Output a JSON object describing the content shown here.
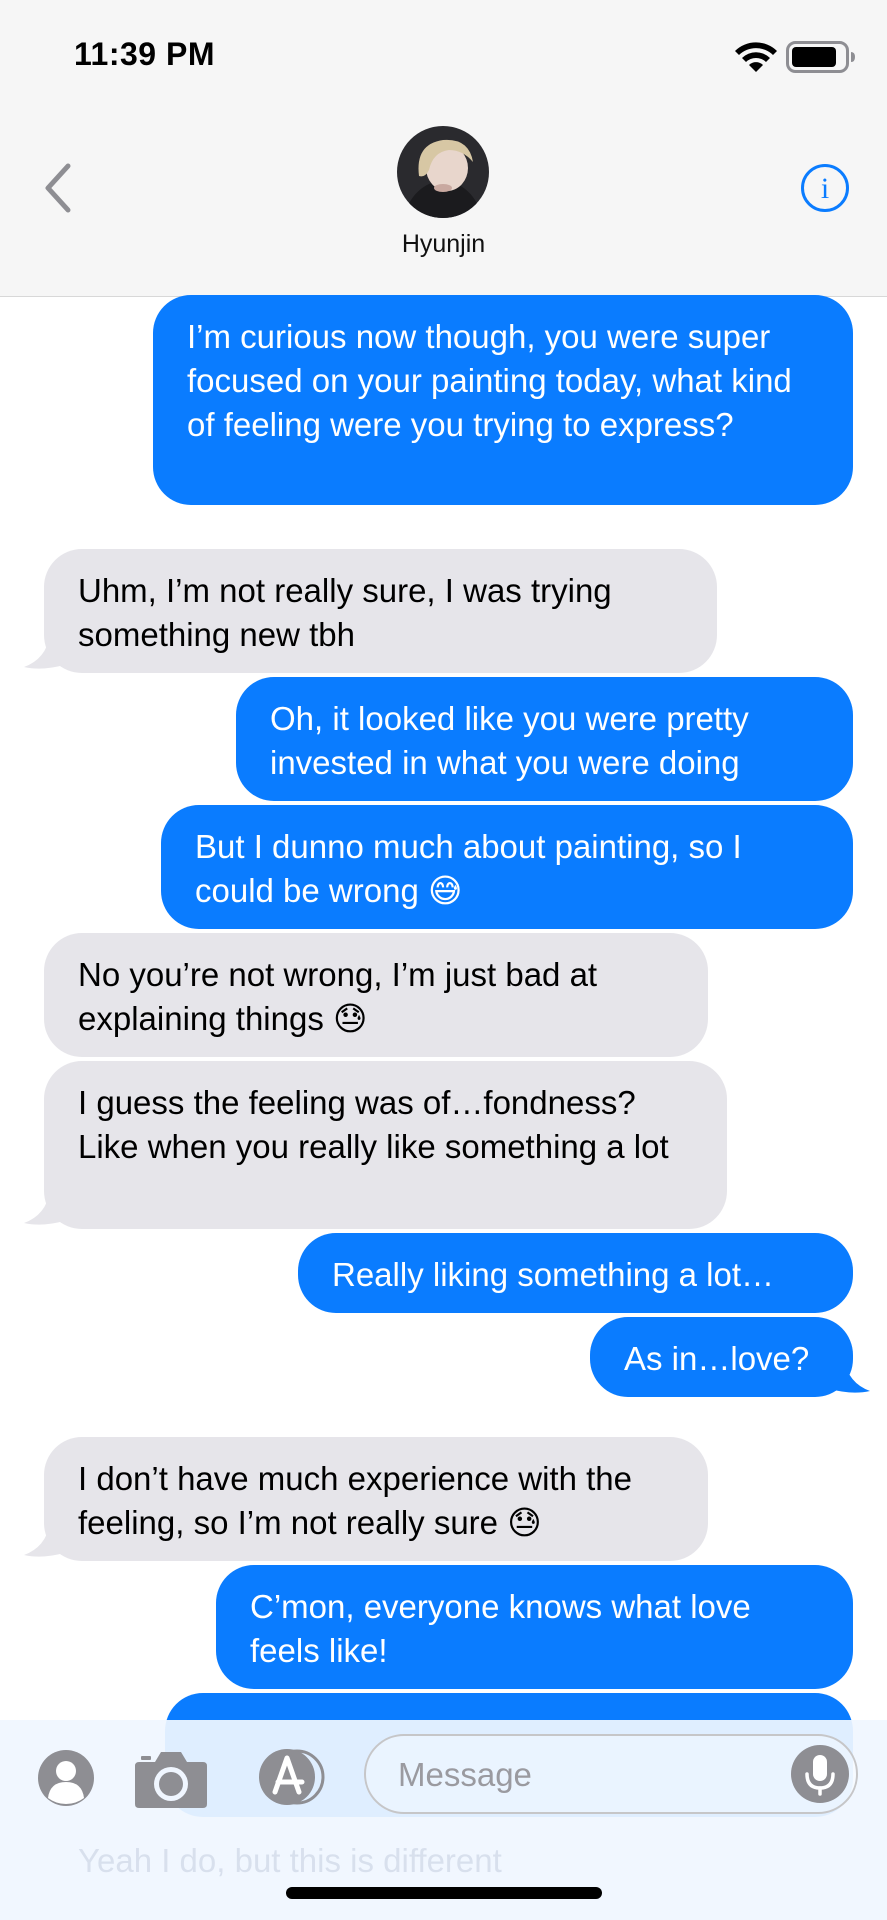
{
  "status_bar": {
    "time": "11:39 PM"
  },
  "header": {
    "contact_name": "Hyunjin"
  },
  "messages": [
    {
      "direction": "out",
      "text": "I’m curious now though, you were super focused on your painting today, what kind of feeling were you trying to express?"
    },
    {
      "direction": "in",
      "text": "Uhm, I’m not really sure, I was trying something new tbh"
    },
    {
      "direction": "out",
      "text": "Oh, it looked like you were pretty invested in what you were doing"
    },
    {
      "direction": "out",
      "text": "But I dunno much about painting, so I could be wrong 😅"
    },
    {
      "direction": "in",
      "text": "No you’re not wrong, I’m just bad at explaining things 😓"
    },
    {
      "direction": "in",
      "text": "I guess the feeling was of…fondness? Like when you really like something a lot"
    },
    {
      "direction": "out",
      "text": "Really liking something a lot…"
    },
    {
      "direction": "out",
      "text": "As in…love?"
    },
    {
      "direction": "in",
      "text": "I don’t have much experience with the feeling, so I’m not really sure 😓"
    },
    {
      "direction": "out",
      "text": "C’mon, everyone knows what love feels like!"
    },
    {
      "direction": "in",
      "text": "Yeah I do, but this is different"
    }
  ],
  "input_bar": {
    "placeholder": "Message"
  },
  "colors": {
    "outgoing_bubble": "#0a7cff",
    "incoming_bubble": "#e6e5ea",
    "accent": "#0a7cff"
  },
  "icons": [
    "back-chevron-icon",
    "info-icon",
    "contact-icon",
    "camera-icon",
    "app-store-icon",
    "microphone-icon",
    "wifi-icon",
    "battery-icon"
  ]
}
